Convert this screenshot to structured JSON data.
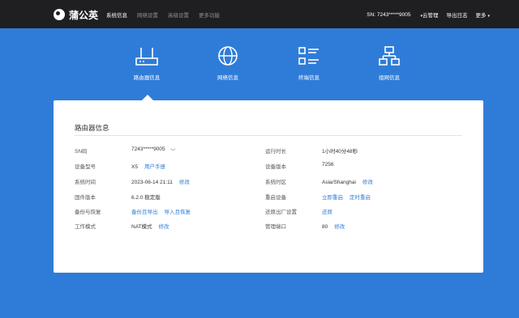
{
  "app": {
    "name": "蒲公英"
  },
  "nav": {
    "items": [
      "系统信息",
      "网络设置",
      "高级设置",
      "更多功能"
    ]
  },
  "topbar": {
    "sn": "SN:  7243*****9005",
    "cloud": "云管理",
    "export_log": "导出日志",
    "more": "更多"
  },
  "icons": [
    {
      "label": "路由器信息",
      "icon": "router-icon"
    },
    {
      "label": "网络信息",
      "icon": "globe-icon"
    },
    {
      "label": "终端信息",
      "icon": "terminal-list-icon"
    },
    {
      "label": "组网信息",
      "icon": "network-topology-icon"
    }
  ],
  "panel": {
    "title": "路由器信息",
    "left": [
      {
        "key": "SN码",
        "value": "7243*****9005",
        "actions": []
      },
      {
        "key": "设备型号",
        "value": "X5",
        "actions": [
          "用户手册"
        ]
      },
      {
        "key": "系统时间",
        "value": "2023-06-14 21:11",
        "actions": [
          "修改"
        ]
      },
      {
        "key": "固件版本",
        "value": "6.2.0 稳定版",
        "actions": []
      },
      {
        "key": "备份与恢复",
        "value": "",
        "actions": [
          "备份且导出",
          "导入且恢复"
        ]
      },
      {
        "key": "工作模式",
        "value": "NAT模式",
        "actions": [
          "修改"
        ]
      }
    ],
    "right": [
      {
        "key": "运行时长",
        "value": "1小时40分48秒",
        "actions": []
      },
      {
        "key": "设备版本",
        "value": "7256",
        "actions": []
      },
      {
        "key": "系统时区",
        "value": "Asia/Shanghai",
        "actions": [
          "修改"
        ]
      },
      {
        "key": "重启设备",
        "value": "",
        "actions": [
          "立即重启",
          "定时重启"
        ]
      },
      {
        "key": "还原出厂设置",
        "value": "",
        "actions": [
          "还原"
        ]
      },
      {
        "key": "管理端口",
        "value": "80",
        "actions": [
          "修改"
        ]
      }
    ]
  },
  "colors": {
    "topbar": "#1f1f21",
    "background": "#2f7cd8",
    "link": "#2f7cd8"
  }
}
